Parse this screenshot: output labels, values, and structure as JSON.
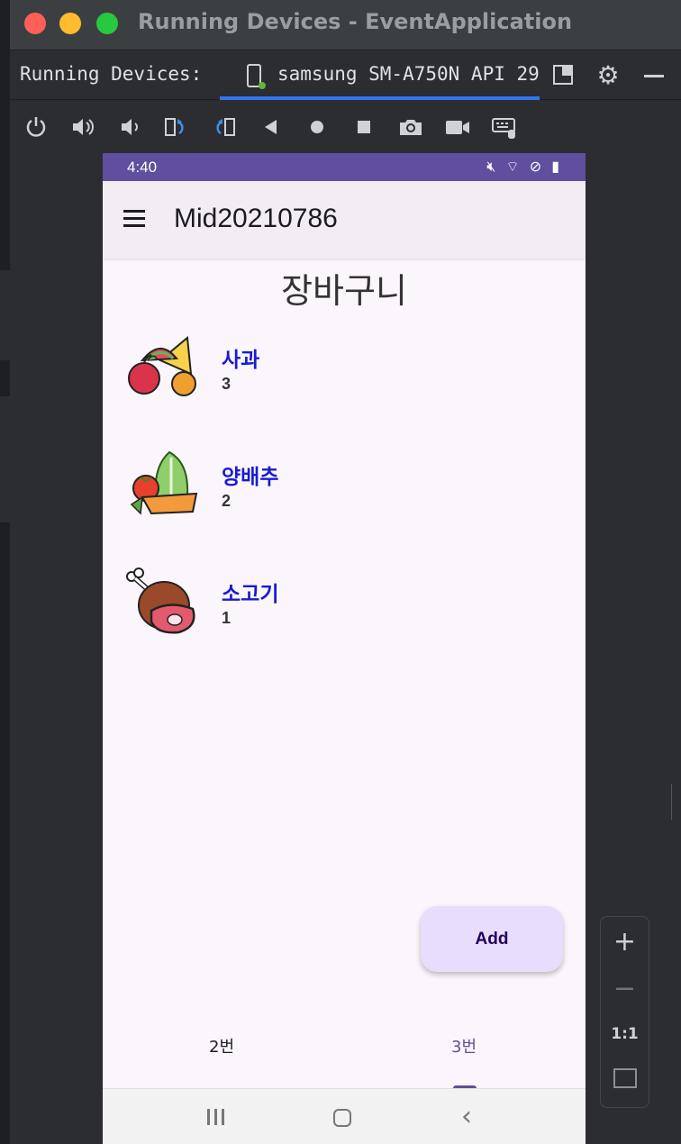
{
  "window": {
    "title": "Running Devices - EventApplication"
  },
  "devices_bar": {
    "label": "Running Devices:",
    "device_tab": "samsung SM-A750N API 29"
  },
  "toolbar": {
    "icons": [
      "power-icon",
      "volume-up-icon",
      "volume-down-icon",
      "rotate-left-icon",
      "rotate-right-icon",
      "back-icon",
      "home-icon",
      "overview-icon",
      "screenshot-icon",
      "screen-record-icon",
      "keyboard-icon"
    ]
  },
  "phone": {
    "status_bar": {
      "time": "4:40",
      "icons": [
        "mute-icon",
        "wifi-icon",
        "dnd-icon",
        "battery-icon"
      ]
    },
    "app_bar": {
      "title": "Mid20210786"
    },
    "page_heading": "장바구니",
    "items": [
      {
        "name": "사과",
        "qty": "3",
        "icon": "fruit-icon"
      },
      {
        "name": "양배추",
        "qty": "2",
        "icon": "vegetable-icon"
      },
      {
        "name": "소고기",
        "qty": "1",
        "icon": "meat-icon"
      }
    ],
    "fab_label": "Add",
    "bottom_tabs": [
      {
        "label": "2번"
      },
      {
        "label": "3번"
      }
    ]
  },
  "zoom_controls": {
    "zoom_in": "+",
    "zoom_out": "−",
    "actual_size": "1:1"
  },
  "colors": {
    "status_bar": "#5f4f9e",
    "item_name": "#1a1ad0",
    "fab_bg": "#e8ddfc",
    "tab_underline": "#3574f0"
  }
}
